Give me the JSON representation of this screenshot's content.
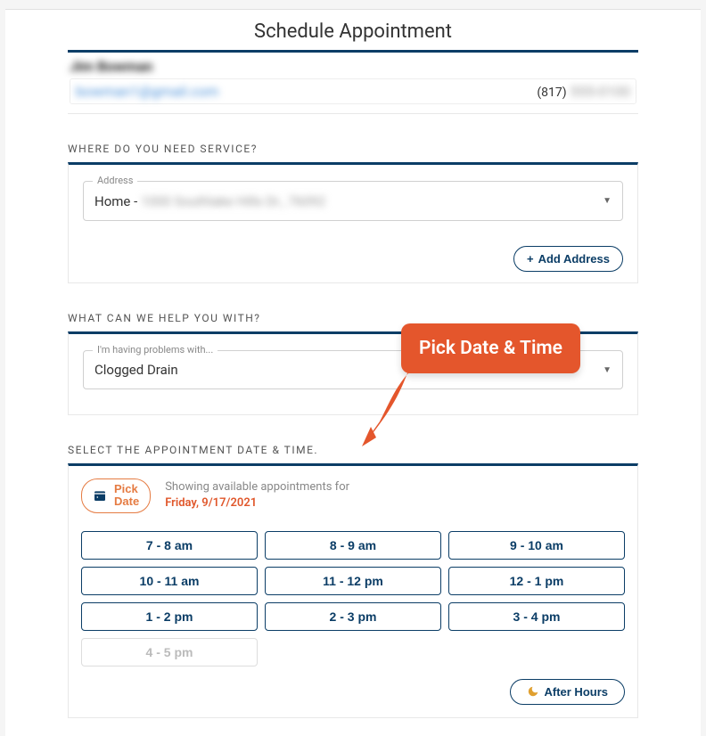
{
  "page": {
    "title": "Schedule Appointment"
  },
  "customer": {
    "name": "Jim Bowman",
    "email": "bowman1@gmail.com",
    "phone_area": "(817)",
    "phone_rest": "555-0100"
  },
  "where": {
    "section_label": "WHERE DO YOU NEED SERVICE?",
    "field_label": "Address",
    "value_prefix": "Home - ",
    "value_rest": "1000 Southlake Hills Dr., 76092",
    "add_button": "Add Address"
  },
  "what": {
    "section_label": "WHAT CAN WE HELP YOU WITH?",
    "field_label": "I'm having problems with...",
    "value": "Clogged Drain"
  },
  "date": {
    "section_label": "SELECT THE APPOINTMENT DATE & TIME.",
    "pick_label": "Pick\nDate",
    "showing_prefix": "Showing available appointments for",
    "showing_date": "Friday, 9/17/2021",
    "after_hours": "After Hours",
    "slots": [
      {
        "label": "7 - 8 am",
        "enabled": true
      },
      {
        "label": "8 - 9 am",
        "enabled": true
      },
      {
        "label": "9 - 10 am",
        "enabled": true
      },
      {
        "label": "10 - 11 am",
        "enabled": true
      },
      {
        "label": "11 - 12 pm",
        "enabled": true
      },
      {
        "label": "12 - 1 pm",
        "enabled": true
      },
      {
        "label": "1 - 2 pm",
        "enabled": true
      },
      {
        "label": "2 - 3 pm",
        "enabled": true
      },
      {
        "label": "3 - 4 pm",
        "enabled": true
      },
      {
        "label": "4 - 5 pm",
        "enabled": false
      }
    ]
  },
  "callout": {
    "text": "Pick Date & Time"
  }
}
